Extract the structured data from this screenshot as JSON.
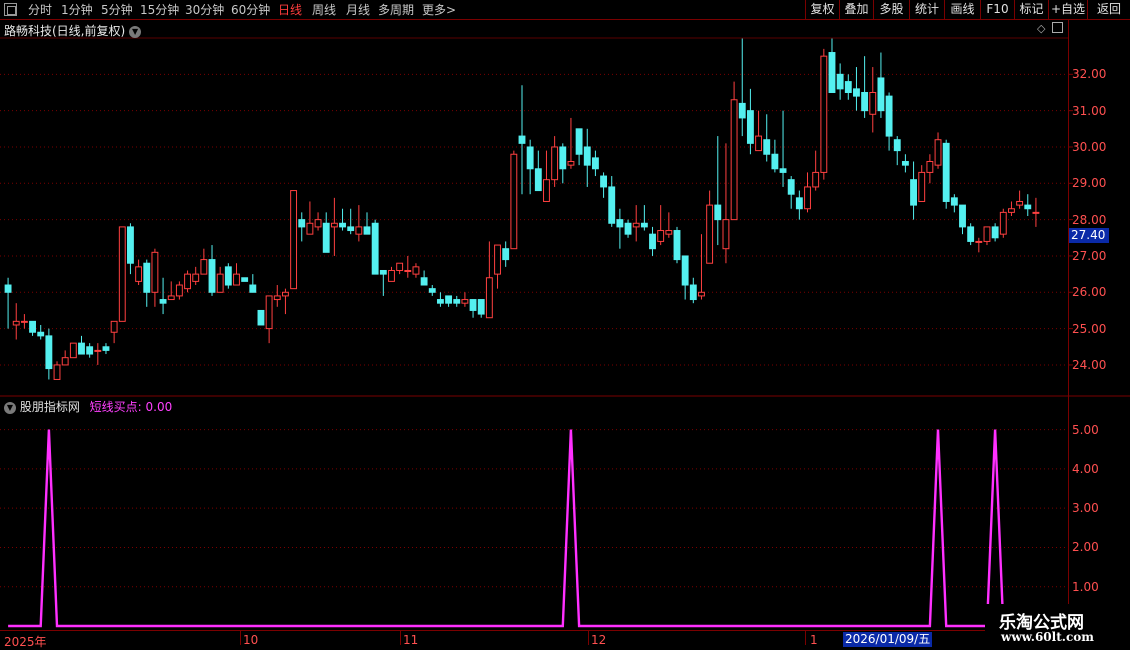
{
  "toolbar": {
    "period_buttons": [
      "分时",
      "1分钟",
      "5分钟",
      "15分钟",
      "30分钟",
      "60分钟",
      "日线",
      "周线",
      "月线",
      "多周期",
      "更多"
    ],
    "active_period": "日线",
    "more_arrow": ">",
    "right_buttons": [
      "复权",
      "叠加",
      "多股",
      "统计",
      "画线",
      "F10",
      "标记",
      "+自选",
      "返回"
    ]
  },
  "chart": {
    "title": "路畅科技(日线,前复权)",
    "current_price_label": "27.40",
    "y_axis_labels": [
      "32.00",
      "31.00",
      "30.00",
      "29.00",
      "28.00",
      "27.00",
      "26.00",
      "25.00",
      "24.00"
    ]
  },
  "indicator": {
    "name": "股朋指标网",
    "value_label": "短线买点: 0.00",
    "y_axis_labels": [
      "5.00",
      "4.00",
      "3.00",
      "2.00",
      "1.00"
    ]
  },
  "date_axis": {
    "labels": [
      "2025年",
      "10",
      "11",
      "12",
      "1"
    ],
    "cursor_date": "2026/01/09/五"
  },
  "watermark": {
    "name": "乐淘公式网",
    "url": "www.60lt.com"
  },
  "colors": {
    "up": "#ff4040",
    "down": "#54f0f0",
    "indicator_line": "#ff30ff",
    "grid": "#7a0000"
  },
  "chart_data": [
    {
      "type": "candlestick",
      "title": "路畅科技(日线,前复权)",
      "ylim": [
        23.2,
        33.0
      ],
      "x_labels": [
        "2025年",
        "10",
        "11",
        "12",
        "1"
      ],
      "candles": [
        [
          26.2,
          26.0,
          25.0,
          26.4
        ],
        [
          25.1,
          25.2,
          24.7,
          25.7
        ],
        [
          25.2,
          25.2,
          25.0,
          25.4
        ],
        [
          25.2,
          24.9,
          24.8,
          25.2
        ],
        [
          24.9,
          24.8,
          24.7,
          25.1
        ],
        [
          24.8,
          23.9,
          23.6,
          25.0
        ],
        [
          23.6,
          24.0,
          23.6,
          24.1
        ],
        [
          24.0,
          24.2,
          24.0,
          24.4
        ],
        [
          24.2,
          24.6,
          24.2,
          24.6
        ],
        [
          24.6,
          24.3,
          24.3,
          24.8
        ],
        [
          24.5,
          24.3,
          24.2,
          24.6
        ],
        [
          24.4,
          24.4,
          24.0,
          24.6
        ],
        [
          24.5,
          24.4,
          24.3,
          24.6
        ],
        [
          24.9,
          25.2,
          24.6,
          25.2
        ],
        [
          25.2,
          27.8,
          25.2,
          27.8
        ],
        [
          27.8,
          26.8,
          26.5,
          27.9
        ],
        [
          26.3,
          26.7,
          26.2,
          26.9
        ],
        [
          26.8,
          26.0,
          25.6,
          26.9
        ],
        [
          26.0,
          27.1,
          25.6,
          27.2
        ],
        [
          25.8,
          25.7,
          25.4,
          26.4
        ],
        [
          25.8,
          25.9,
          25.8,
          26.3
        ],
        [
          25.9,
          26.2,
          25.8,
          26.3
        ],
        [
          26.1,
          26.5,
          26.0,
          26.6
        ],
        [
          26.3,
          26.5,
          26.2,
          26.7
        ],
        [
          26.5,
          26.9,
          26.5,
          27.2
        ],
        [
          26.9,
          26.0,
          25.9,
          27.3
        ],
        [
          26.0,
          26.5,
          26.0,
          26.7
        ],
        [
          26.7,
          26.2,
          26.1,
          26.8
        ],
        [
          26.2,
          26.5,
          26.2,
          26.8
        ],
        [
          26.4,
          26.3,
          26.3,
          26.4
        ],
        [
          26.2,
          26.0,
          26.0,
          26.5
        ],
        [
          25.5,
          25.1,
          25.1,
          25.5
        ],
        [
          25.0,
          25.9,
          24.6,
          25.9
        ],
        [
          25.8,
          25.9,
          25.6,
          26.2
        ],
        [
          25.9,
          26.0,
          25.4,
          26.1
        ],
        [
          26.1,
          28.8,
          26.1,
          28.8
        ],
        [
          28.0,
          27.8,
          27.4,
          28.2
        ],
        [
          27.6,
          27.9,
          27.6,
          28.5
        ],
        [
          27.8,
          28.0,
          27.7,
          28.2
        ],
        [
          27.9,
          27.1,
          27.1,
          28.2
        ],
        [
          27.8,
          27.9,
          27.0,
          28.6
        ],
        [
          27.9,
          27.8,
          27.7,
          28.3
        ],
        [
          27.8,
          27.7,
          27.6,
          28.3
        ],
        [
          27.6,
          27.8,
          27.4,
          28.4
        ],
        [
          27.8,
          27.6,
          27.6,
          28.2
        ],
        [
          27.9,
          26.5,
          26.5,
          28.0
        ],
        [
          26.6,
          26.5,
          25.9,
          26.6
        ],
        [
          26.3,
          26.6,
          26.3,
          26.7
        ],
        [
          26.6,
          26.8,
          26.5,
          26.8
        ],
        [
          26.6,
          26.6,
          26.4,
          27.0
        ],
        [
          26.5,
          26.7,
          26.4,
          26.8
        ],
        [
          26.4,
          26.2,
          26.2,
          26.6
        ],
        [
          26.1,
          26.0,
          25.9,
          26.2
        ],
        [
          25.8,
          25.7,
          25.6,
          26.0
        ],
        [
          25.9,
          25.7,
          25.6,
          25.9
        ],
        [
          25.8,
          25.7,
          25.6,
          25.9
        ],
        [
          25.7,
          25.8,
          25.6,
          26.0
        ],
        [
          25.8,
          25.5,
          25.3,
          25.8
        ],
        [
          25.8,
          25.4,
          25.3,
          25.8
        ],
        [
          25.3,
          26.4,
          25.3,
          27.4
        ],
        [
          26.5,
          27.3,
          26.1,
          27.3
        ],
        [
          27.2,
          26.9,
          26.7,
          27.4
        ],
        [
          27.2,
          29.8,
          27.2,
          29.9
        ],
        [
          30.3,
          30.1,
          28.7,
          31.7
        ],
        [
          30.0,
          29.4,
          28.7,
          30.2
        ],
        [
          29.4,
          28.8,
          28.8,
          29.9
        ],
        [
          28.5,
          29.1,
          28.5,
          29.9
        ],
        [
          29.1,
          30.0,
          28.9,
          30.3
        ],
        [
          30.0,
          29.4,
          29.0,
          30.1
        ],
        [
          29.5,
          29.6,
          29.4,
          30.8
        ],
        [
          30.5,
          29.8,
          29.5,
          30.4
        ],
        [
          30.0,
          29.5,
          28.9,
          30.5
        ],
        [
          29.7,
          29.4,
          29.2,
          29.9
        ],
        [
          29.2,
          28.9,
          28.6,
          29.3
        ],
        [
          28.9,
          27.9,
          27.8,
          29.2
        ],
        [
          28.0,
          27.8,
          27.2,
          28.3
        ],
        [
          27.9,
          27.6,
          27.5,
          28.0
        ],
        [
          27.8,
          27.9,
          27.4,
          28.4
        ],
        [
          27.9,
          27.8,
          27.7,
          28.4
        ],
        [
          27.6,
          27.2,
          27.0,
          27.8
        ],
        [
          27.4,
          27.7,
          27.3,
          28.4
        ],
        [
          27.6,
          27.7,
          27.5,
          28.2
        ],
        [
          27.7,
          26.9,
          26.8,
          27.8
        ],
        [
          27.0,
          26.2,
          25.8,
          27.0
        ],
        [
          26.2,
          25.8,
          25.7,
          26.4
        ],
        [
          25.9,
          26.0,
          25.8,
          27.6
        ],
        [
          26.8,
          28.4,
          26.8,
          28.8
        ],
        [
          28.4,
          28.0,
          27.3,
          30.3
        ],
        [
          27.2,
          28.0,
          26.8,
          30.1
        ],
        [
          28.0,
          31.3,
          28.0,
          31.8
        ],
        [
          31.2,
          30.8,
          30.3,
          33.0
        ],
        [
          31.0,
          30.1,
          29.8,
          31.6
        ],
        [
          29.9,
          30.3,
          29.9,
          31.0
        ],
        [
          30.2,
          29.8,
          29.6,
          30.9
        ],
        [
          29.8,
          29.4,
          29.3,
          30.2
        ],
        [
          29.4,
          29.3,
          28.9,
          31.0
        ],
        [
          29.1,
          28.7,
          28.3,
          29.2
        ],
        [
          28.6,
          28.3,
          28.0,
          28.8
        ],
        [
          28.3,
          28.9,
          28.2,
          29.3
        ],
        [
          28.9,
          29.3,
          28.8,
          29.9
        ],
        [
          29.3,
          32.5,
          29.1,
          32.7
        ],
        [
          32.6,
          31.5,
          31.5,
          33.0
        ],
        [
          32.0,
          31.6,
          31.3,
          32.3
        ],
        [
          31.8,
          31.5,
          31.3,
          32.0
        ],
        [
          31.6,
          31.4,
          31.0,
          32.2
        ],
        [
          31.5,
          31.0,
          30.8,
          32.5
        ],
        [
          30.9,
          31.5,
          30.4,
          32.2
        ],
        [
          31.9,
          31.0,
          30.8,
          32.6
        ],
        [
          31.4,
          30.3,
          29.9,
          31.5
        ],
        [
          30.2,
          29.9,
          29.5,
          30.3
        ],
        [
          29.6,
          29.5,
          29.3,
          29.8
        ],
        [
          29.1,
          28.4,
          28.0,
          29.6
        ],
        [
          28.5,
          29.3,
          28.5,
          29.5
        ],
        [
          29.3,
          29.6,
          29.0,
          29.8
        ],
        [
          29.5,
          30.2,
          29.4,
          30.4
        ],
        [
          30.1,
          28.5,
          28.3,
          30.2
        ],
        [
          28.6,
          28.4,
          28.2,
          28.7
        ],
        [
          28.4,
          27.8,
          27.6,
          28.4
        ],
        [
          27.8,
          27.4,
          27.3,
          27.9
        ],
        [
          27.4,
          27.4,
          27.1,
          27.5
        ],
        [
          27.4,
          27.8,
          27.3,
          27.8
        ],
        [
          27.8,
          27.5,
          27.4,
          27.9
        ],
        [
          27.6,
          28.2,
          27.5,
          28.3
        ],
        [
          28.2,
          28.3,
          28.1,
          28.5
        ],
        [
          28.4,
          28.5,
          28.3,
          28.8
        ],
        [
          28.4,
          28.3,
          28.1,
          28.7
        ],
        [
          28.2,
          28.2,
          27.8,
          28.6
        ]
      ]
    },
    {
      "type": "line",
      "title": "短线买点",
      "ylim": [
        0,
        5.5
      ],
      "spikes": [
        {
          "index": 5,
          "value": 5.0
        },
        {
          "index": 69,
          "value": 5.0
        },
        {
          "index": 114,
          "value": 5.0
        },
        {
          "index": 121,
          "value": 5.0
        }
      ]
    }
  ]
}
